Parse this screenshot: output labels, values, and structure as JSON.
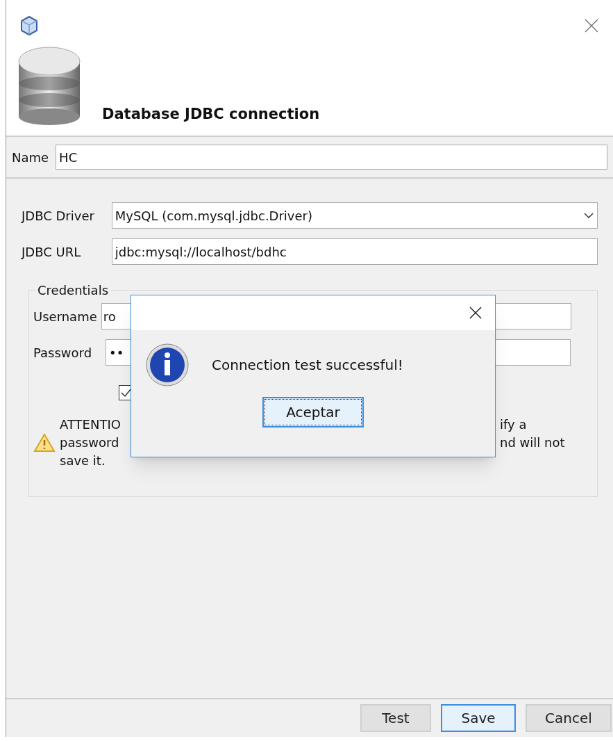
{
  "header": {
    "title": "Database JDBC connection"
  },
  "name_field": {
    "label": "Name",
    "value": "HC"
  },
  "driver": {
    "label": "JDBC Driver",
    "value": "MySQL (com.mysql.jdbc.Driver)"
  },
  "url": {
    "label": "JDBC URL",
    "value": "jdbc:mysql://localhost/bdhc"
  },
  "credentials": {
    "legend": "Credentials",
    "username": {
      "label": "Username",
      "value": "ro"
    },
    "password": {
      "label": "Password",
      "value": "••"
    },
    "checkbox": {
      "checked": true
    },
    "warning": {
      "left_lines": [
        "ATTENTIO",
        "password",
        "save it."
      ],
      "right_lines": [
        "ify a",
        "nd will not"
      ]
    }
  },
  "buttons": [
    {
      "label": "Test",
      "focused": false
    },
    {
      "label": "Save",
      "focused": true
    },
    {
      "label": "Cancel",
      "focused": false
    }
  ],
  "dialog": {
    "message": "Connection test successful!",
    "button": {
      "label": "Aceptar",
      "focused": true
    }
  }
}
